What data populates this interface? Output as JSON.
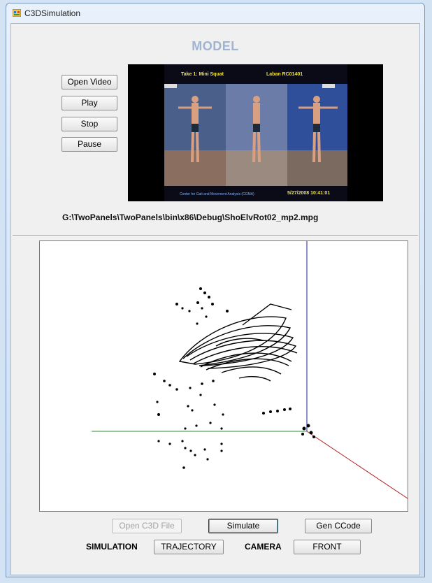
{
  "window": {
    "title": "C3DSimulation"
  },
  "model": {
    "heading": "MODEL",
    "buttons": {
      "open_video": "Open Video",
      "play": "Play",
      "stop": "Stop",
      "pause": "Pause"
    },
    "video": {
      "title_left": "Take 1: Mini Squat",
      "title_right": "Laban RC01401",
      "footer_left": "Center for Gait and Movement Analysis (CGMA)",
      "footer_right": "5/27/2008 10:41:01"
    },
    "file_path": "G:\\TwoPanels\\TwoPanels\\bin\\x86\\Debug\\ShoElvRot02_mp2.mpg"
  },
  "toolbar": {
    "open_c3d": "Open C3D File",
    "simulate": "Simulate",
    "gen_ccode": "Gen CCode",
    "simulation_label": "SIMULATION",
    "trajectory": "TRAJECTORY",
    "camera_label": "CAMERA",
    "front": "FRONT"
  },
  "colors": {
    "x_axis": "#2e8b2e",
    "y_axis": "#1e1e9c",
    "z_axis": "#b22222",
    "heading": "#9fb3d3"
  },
  "icons": {
    "app": "window-app-icon"
  }
}
